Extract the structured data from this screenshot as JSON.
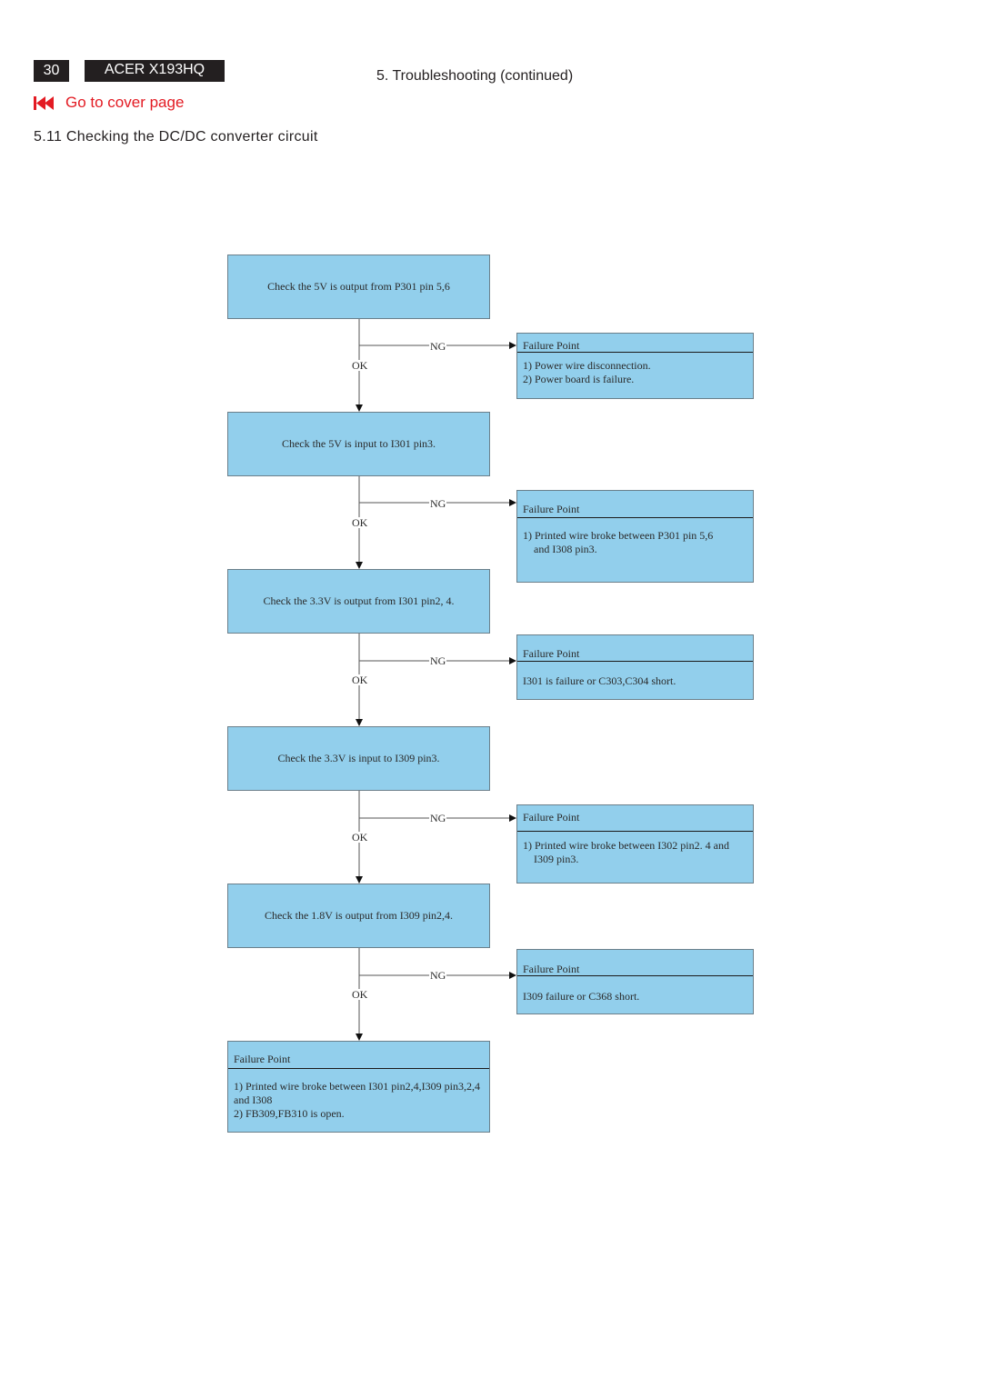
{
  "header": {
    "page_number": "30",
    "model": "ACER X193HQ",
    "section": "5. Troubleshooting (continued)",
    "cover_link": "Go to cover page",
    "cover_icon": "rewind-to-start-icon",
    "subtitle": "5.11 Checking the DC/DC converter circuit"
  },
  "colors": {
    "box_fill": "#92cfec",
    "header_bg": "#231f20",
    "link_red": "#e31b23"
  },
  "flowchart": {
    "ok_label": "OK",
    "ng_label": "NG",
    "steps": [
      {
        "check": "Check the 5V is output from P301 pin 5,6",
        "failure": {
          "title": "Failure Point",
          "lines": [
            "1) Power wire disconnection.",
            "2) Power board is failure."
          ]
        }
      },
      {
        "check": "Check the 5V is input to I301 pin3.",
        "failure": {
          "title": "Failure Point",
          "lines": [
            "1) Printed wire broke between P301 pin 5,6",
            "    and I308 pin3."
          ]
        }
      },
      {
        "check": "Check the 3.3V is output from I301 pin2, 4.",
        "failure": {
          "title": "Failure Point",
          "lines": [
            "I301 is failure or C303,C304 short."
          ]
        }
      },
      {
        "check": "Check the 3.3V is input to I309 pin3.",
        "failure": {
          "title": "Failure Point",
          "lines": [
            "1) Printed wire broke between I302 pin2. 4 and",
            "    I309 pin3."
          ]
        }
      },
      {
        "check": "Check the 1.8V is output from I309 pin2,4.",
        "failure": {
          "title": "Failure Point",
          "lines": [
            "I309 failure or C368 short."
          ]
        }
      }
    ],
    "final": {
      "title": "Failure Point",
      "lines": [
        "1) Printed wire broke between I301 pin2,4,I309 pin3,2,4",
        "and I308",
        "2) FB309,FB310 is open."
      ]
    }
  }
}
